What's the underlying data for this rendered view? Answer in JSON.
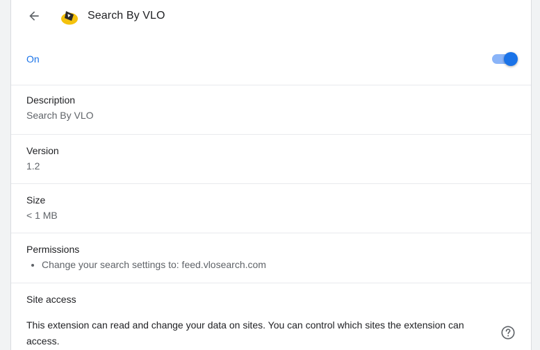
{
  "header": {
    "title": "Search By VLO",
    "back_icon": "arrow-back-icon",
    "extension_icon": "vlo-extension-icon"
  },
  "status": {
    "on_label": "On",
    "enabled": true
  },
  "details": {
    "description": {
      "label": "Description",
      "value": "Search By VLO"
    },
    "version": {
      "label": "Version",
      "value": "1.2"
    },
    "size": {
      "label": "Size",
      "value": "< 1 MB"
    },
    "permissions": {
      "label": "Permissions",
      "items": [
        "Change your search settings to: feed.vlosearch.com"
      ]
    },
    "site_access": {
      "label": "Site access",
      "text": "This extension can read and change your data on sites. You can control which sites the extension can access.",
      "help_icon": "help-circle-icon"
    }
  },
  "colors": {
    "accent": "#1a73e8",
    "toggle_track": "#8ab4f8"
  }
}
